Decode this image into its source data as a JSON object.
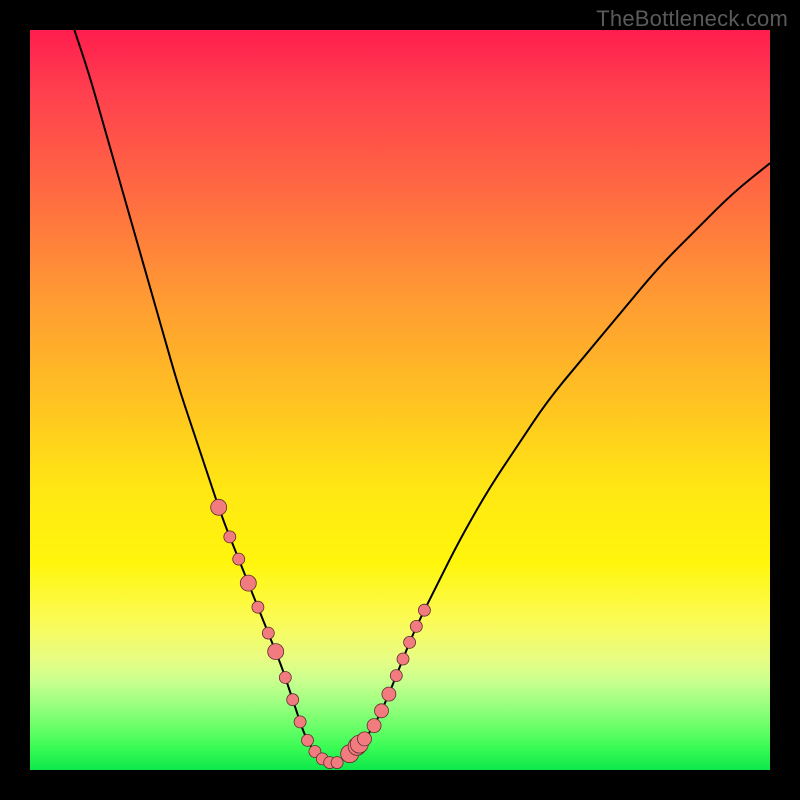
{
  "watermark": "TheBottleneck.com",
  "chart_data": {
    "type": "line",
    "title": "",
    "xlabel": "",
    "ylabel": "",
    "xlim": [
      0,
      100
    ],
    "ylim": [
      0,
      100
    ],
    "grid": false,
    "series": [
      {
        "name": "bottleneck-curve",
        "x": [
          6,
          8,
          10,
          12,
          14,
          16,
          18,
          20,
          22,
          24,
          26,
          28,
          30,
          32,
          34,
          35,
          36,
          37,
          38,
          40,
          42,
          44,
          46,
          48,
          50,
          52,
          55,
          58,
          62,
          66,
          70,
          75,
          80,
          85,
          90,
          95,
          100
        ],
        "values": [
          100,
          94,
          87,
          80,
          73,
          66,
          59,
          52,
          46,
          40,
          34,
          29,
          24,
          19,
          14,
          11,
          8,
          5,
          3,
          1,
          1,
          3,
          5,
          9,
          14,
          19,
          25,
          31,
          38,
          44,
          50,
          56,
          62,
          68,
          73,
          78,
          82
        ]
      }
    ],
    "markers": {
      "left_cluster_x": [
        25.5,
        27,
        28.2,
        29.5,
        30.8,
        32.2,
        33.2
      ],
      "right_cluster_x": [
        43.2,
        44.2,
        44.5,
        45.2,
        46.5,
        47.5,
        48.5,
        49.5,
        50.4,
        51.3,
        52.2,
        53.3
      ],
      "bottom_cluster_x": [
        34.5,
        35.5,
        36.5,
        37.5,
        38.5,
        39.5,
        40.5,
        41.5
      ]
    }
  }
}
